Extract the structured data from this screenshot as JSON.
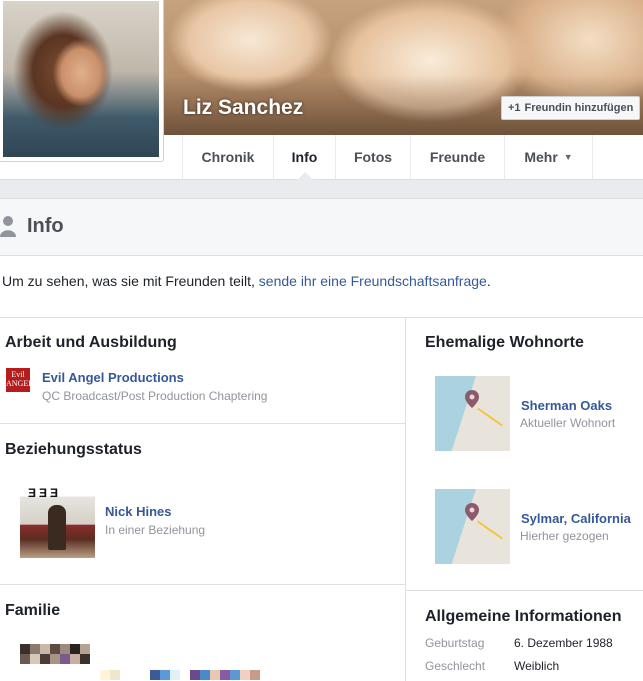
{
  "profile": {
    "name": "Liz Sanchez",
    "add_friend_label": "Freundin hinzufügen"
  },
  "nav": {
    "tabs": [
      {
        "label": "Chronik"
      },
      {
        "label": "Info"
      },
      {
        "label": "Fotos"
      },
      {
        "label": "Freunde"
      },
      {
        "label": "Mehr"
      }
    ]
  },
  "info": {
    "title": "Info",
    "notice_text": "Um zu sehen, was sie mit Freunden teilt, ",
    "notice_link": "sende ihr eine Freundschaftsanfrage",
    "notice_end": "."
  },
  "work": {
    "title": "Arbeit und Ausbildung",
    "logo_text": "Evil ANGEL",
    "employer": "Evil Angel Productions",
    "position": "QC Broadcast/Post Production Chaptering"
  },
  "relationship": {
    "title": "Beziehungsstatus",
    "partner": "Nick Hines",
    "status": "In einer Beziehung"
  },
  "family": {
    "title": "Familie"
  },
  "places": {
    "title": "Ehemalige Wohnorte",
    "items": [
      {
        "name": "Sherman Oaks",
        "sub": "Aktueller Wohnort"
      },
      {
        "name": "Sylmar, California",
        "sub": "Hierher gezogen"
      }
    ]
  },
  "general": {
    "title": "Allgemeine Informationen",
    "rows": [
      {
        "label": "Geburtstag",
        "value": "6. Dezember 1988"
      },
      {
        "label": "Geschlecht",
        "value": "Weiblich"
      }
    ]
  },
  "colors": {
    "link": "#365899",
    "background": "#e9ebee"
  }
}
